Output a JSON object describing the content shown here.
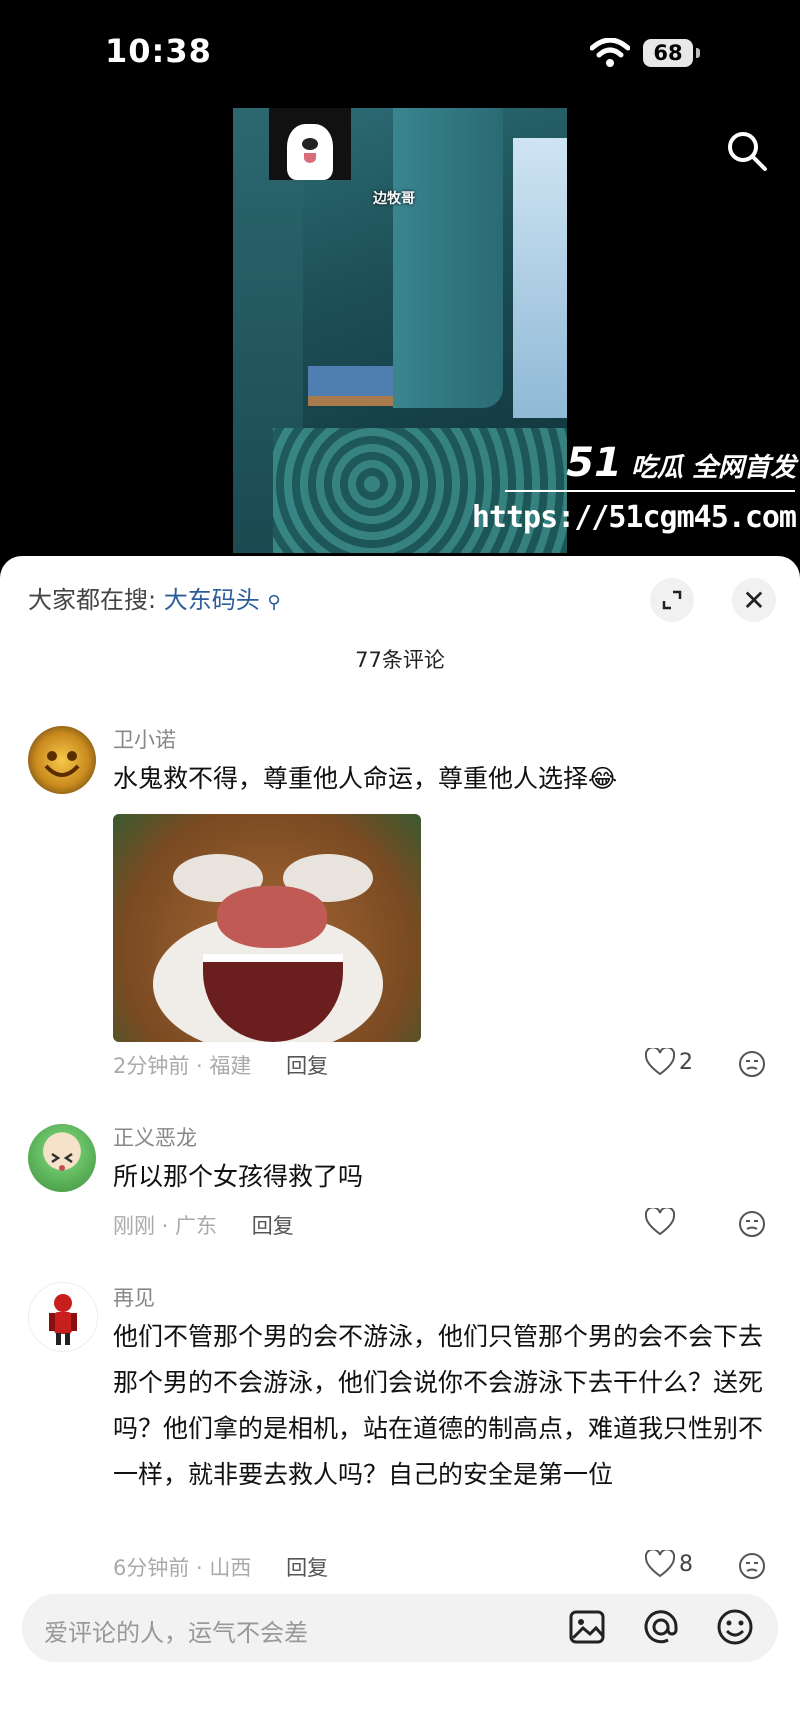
{
  "status_bar": {
    "time": "10:38",
    "battery": "68"
  },
  "video": {
    "overlay_tag": "边牧哥"
  },
  "watermark": {
    "brand_number": "51",
    "brand_text": "吃瓜 全网首发",
    "url": "https://51cgm45.com"
  },
  "comments_sheet": {
    "hot_search_label": "大家都在搜:",
    "hot_search_keyword": "大东码头",
    "comment_count": "77条评论",
    "comments": [
      {
        "username": "卫小诺",
        "text": "水鬼救不得，尊重他人命运，尊重他人选择😂",
        "time_location": "2分钟前 · 福建",
        "reply": "回复",
        "likes": "2"
      },
      {
        "username": "正义恶龙",
        "text": "所以那个女孩得救了吗",
        "time_location": "刚刚 · 广东",
        "reply": "回复",
        "likes": ""
      },
      {
        "username": "再见",
        "text": "他们不管那个男的会不游泳，他们只管那个男的会不会下去那个男的不会游泳，他们会说你不会游泳下去干什么？送死吗？他们拿的是相机，站在道德的制高点，难道我只性别不一样，就非要去救人吗？自己的安全是第一位",
        "time_location": "6分钟前 · 山西",
        "reply": "回复",
        "likes": "8"
      }
    ],
    "composer_placeholder": "爱评论的人，运气不会差"
  },
  "colors": {
    "keyword": "#2b5d9b",
    "sheet_bg": "#ffffff"
  }
}
